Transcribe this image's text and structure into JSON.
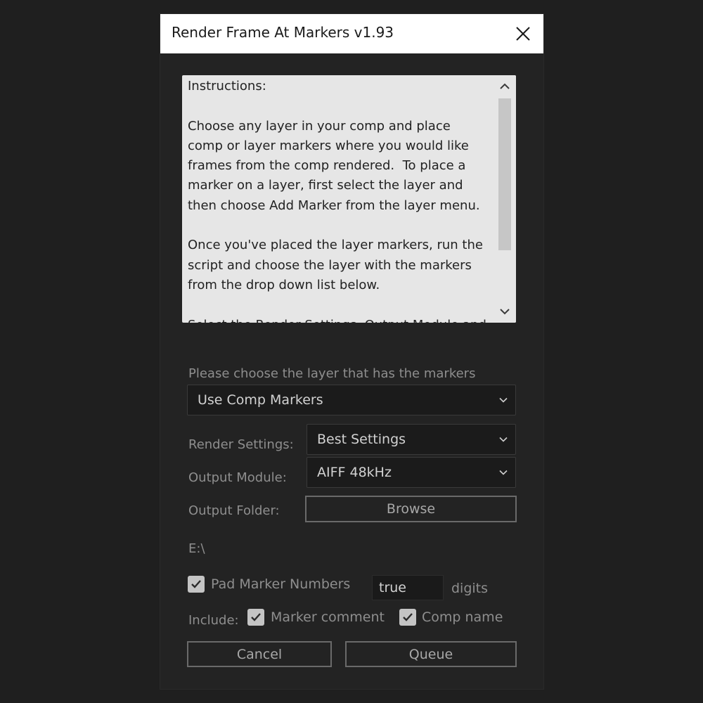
{
  "window": {
    "title": "Render Frame At Markers v1.93"
  },
  "instructions": {
    "text": "Instructions:\n\nChoose any layer in your comp and place\ncomp or layer markers where you would like\nframes from the comp rendered.  To place a\nmarker on a layer, first select the layer and\nthen choose Add Marker from the layer menu.\n\nOnce you've placed the layer markers, run the\nscript and choose the layer with the markers\nfrom the drop down list below.\n\nSelect the Render Settings, Output Module and"
  },
  "layer_select": {
    "label": "Please choose the layer that has the markers",
    "value": "Use Comp Markers"
  },
  "render_settings": {
    "label": "Render Settings:",
    "value": "Best Settings"
  },
  "output_module": {
    "label": "Output Module:",
    "value": "AIFF 48kHz"
  },
  "output_folder": {
    "label": "Output Folder:",
    "button": "Browse",
    "path": "E:\\"
  },
  "pad": {
    "label": "Pad Marker Numbers",
    "checked": true,
    "value": "true",
    "suffix": "digits"
  },
  "include": {
    "label": "Include:",
    "marker_comment": {
      "label": "Marker comment",
      "checked": true
    },
    "comp_name": {
      "label": "Comp name",
      "checked": true
    }
  },
  "actions": {
    "cancel": "Cancel",
    "queue": "Queue"
  },
  "icons": {
    "close": "close-icon",
    "scroll_up": "chevron-up-icon",
    "scroll_down": "chevron-down-icon",
    "dropdown": "chevron-down-icon",
    "check": "checkmark-icon"
  },
  "colors": {
    "background": "#1f1f1f",
    "dialog": "#232323",
    "titlebar": "#ffffff",
    "instructions_bg": "#e6e6e6",
    "label_text": "#8e8e8e",
    "field_bg": "#1b1b1b",
    "checkbox": "#c4c4c4"
  }
}
